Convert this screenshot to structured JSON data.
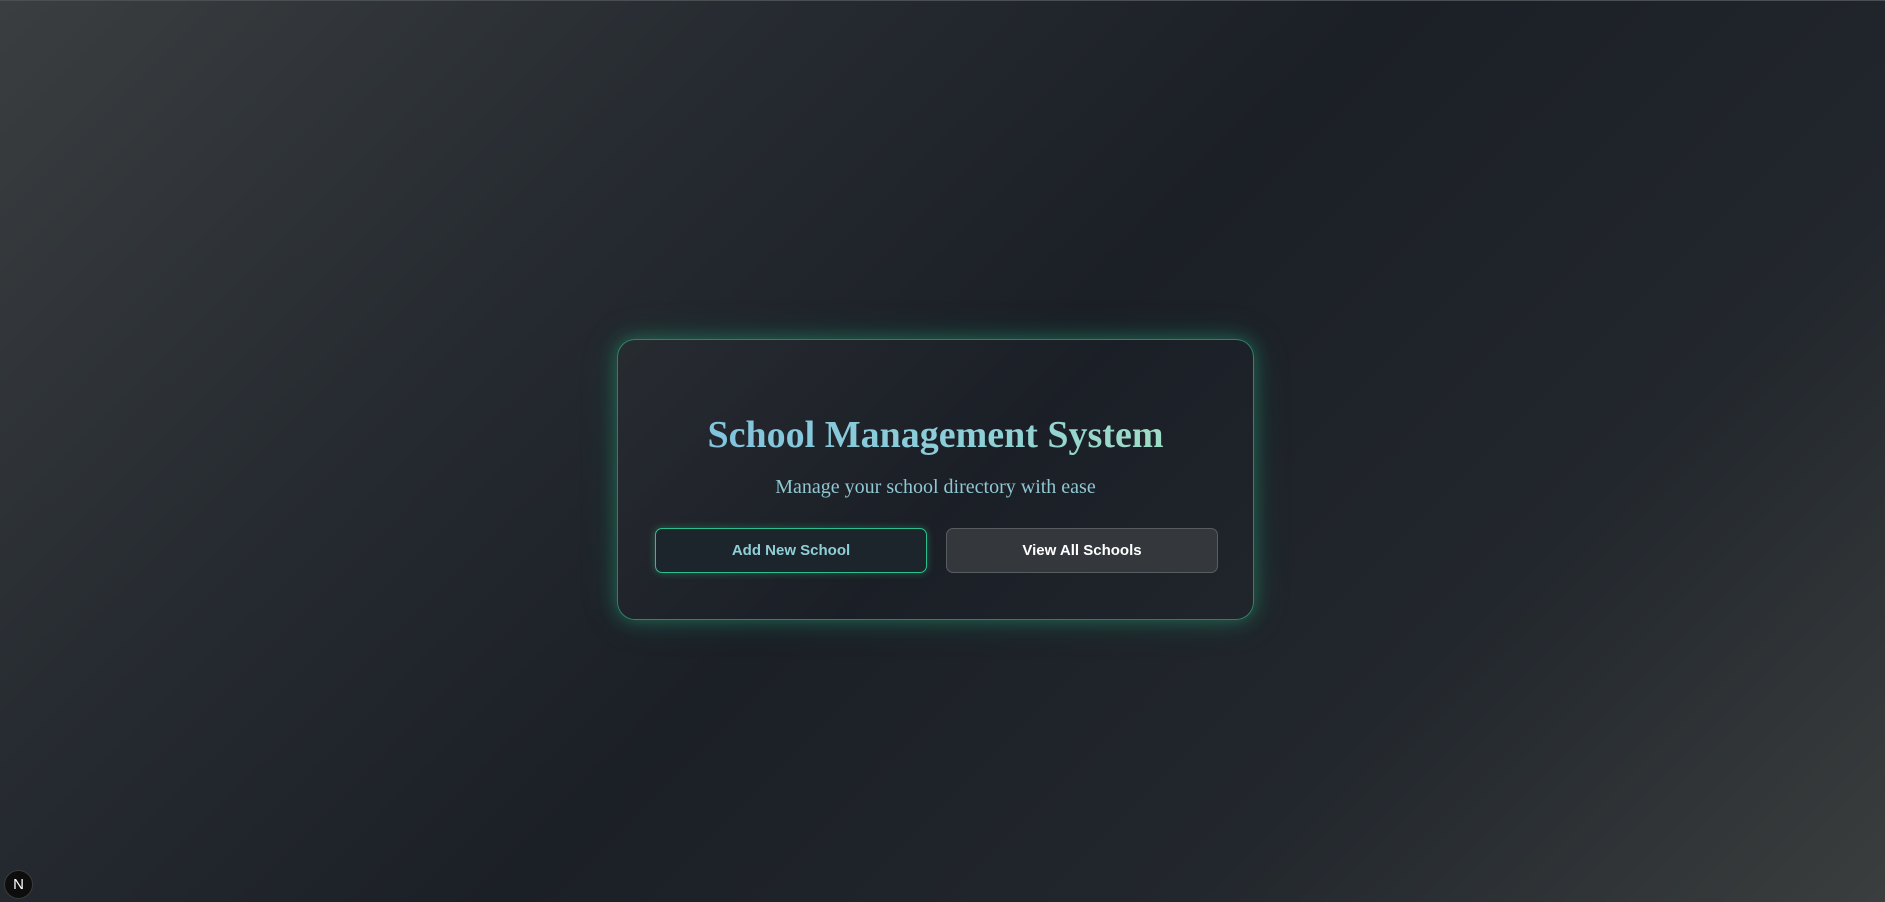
{
  "main": {
    "title": "School Management System",
    "subtitle": "Manage your school directory with ease",
    "buttons": {
      "add_label": "Add New School",
      "view_label": "View All Schools"
    }
  },
  "dev_badge": {
    "icon": "next-logo-icon",
    "glyph": "N"
  },
  "colors": {
    "accent": "#34d399",
    "title_gradient_start": "#7fbfe0",
    "title_gradient_end": "#a6e3bc",
    "subtitle": "#8fc7d2",
    "background": "#1b1f26"
  }
}
